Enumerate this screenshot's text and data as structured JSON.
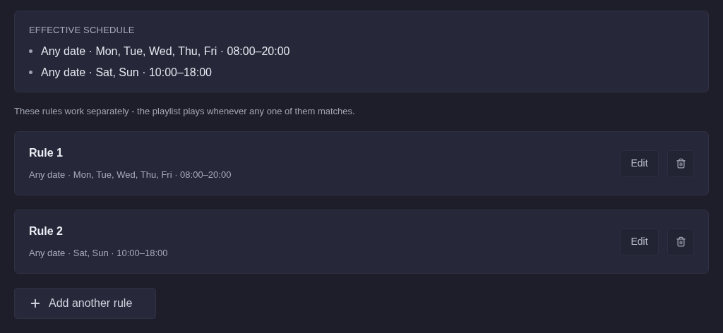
{
  "summary": {
    "title": "EFFECTIVE SCHEDULE",
    "items": [
      "Any date · Mon, Tue, Wed, Thu, Fri · 08:00–20:00",
      "Any date · Sat, Sun · 10:00–18:00"
    ]
  },
  "note": "These rules work separately - the playlist plays whenever any one of them matches.",
  "rules": [
    {
      "title": "Rule 1",
      "description": "Any date · Mon, Tue, Wed, Thu, Fri · 08:00–20:00",
      "edit": "Edit"
    },
    {
      "title": "Rule 2",
      "description": "Any date · Sat, Sun · 10:00–18:00",
      "edit": "Edit"
    }
  ],
  "add_button": "Add another rule"
}
